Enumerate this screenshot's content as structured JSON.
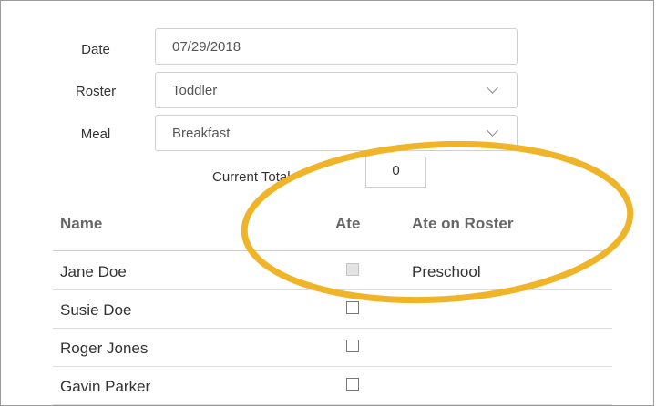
{
  "form": {
    "date_label": "Date",
    "date_value": "07/29/2018",
    "roster_label": "Roster",
    "roster_value": "Toddler",
    "meal_label": "Meal",
    "meal_value": "Breakfast"
  },
  "total": {
    "label": "Current Total",
    "value": "0"
  },
  "table": {
    "headers": {
      "name": "Name",
      "ate": "Ate",
      "ate_on_roster": "Ate on Roster"
    },
    "rows": [
      {
        "name": "Jane Doe",
        "ate": false,
        "ate_disabled": true,
        "ate_on_roster": "Preschool"
      },
      {
        "name": "Susie Doe",
        "ate": false,
        "ate_disabled": false,
        "ate_on_roster": ""
      },
      {
        "name": "Roger Jones",
        "ate": false,
        "ate_disabled": false,
        "ate_on_roster": ""
      },
      {
        "name": "Gavin Parker",
        "ate": false,
        "ate_disabled": false,
        "ate_on_roster": ""
      }
    ]
  },
  "annotation": {
    "color": "#F0B429",
    "shape": "ellipse-highlight"
  }
}
